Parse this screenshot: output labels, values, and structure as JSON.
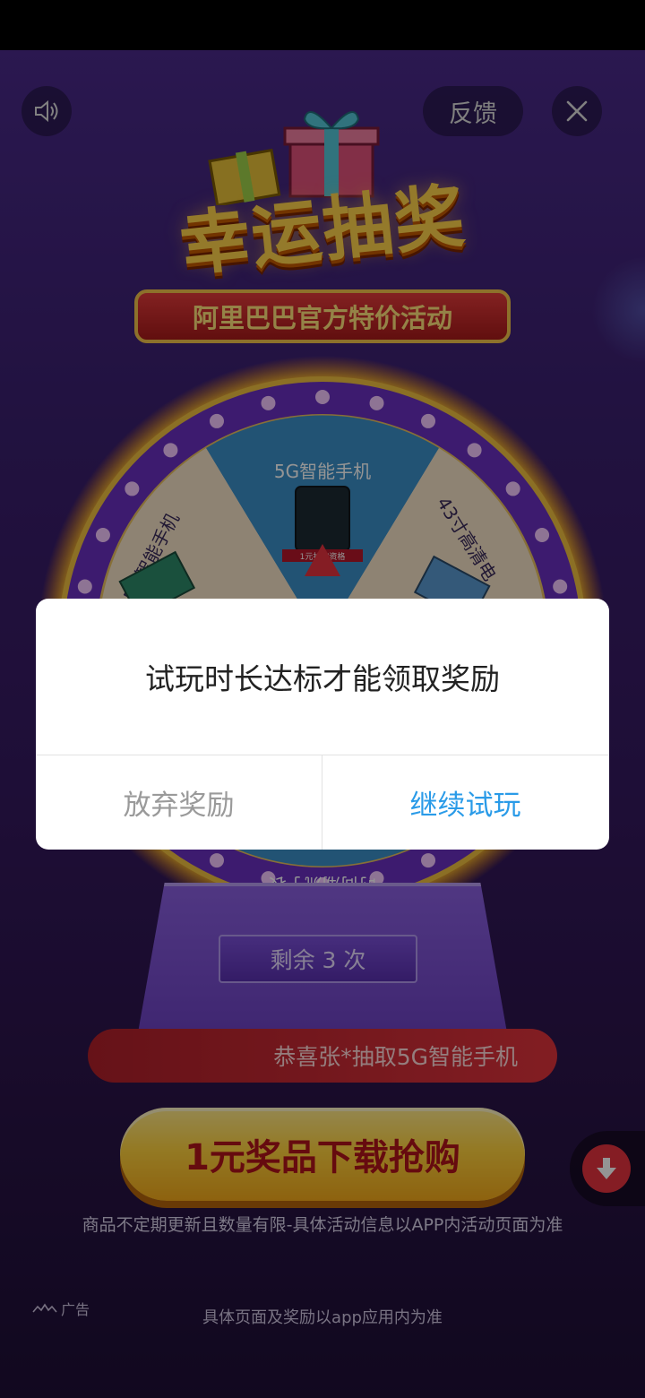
{
  "top_controls": {
    "sound_icon": "speaker-icon",
    "feedback_label": "反馈",
    "close_icon": "close-icon"
  },
  "banner": {
    "title": "幸运抽奖",
    "subtitle": "阿里巴巴官方特价活动"
  },
  "wheel": {
    "prizes": [
      "5G智能手机",
      "43寸高清电",
      "时尚潮流手表",
      "5G智能手机"
    ],
    "price_tag": "1元抢购资格"
  },
  "remaining_label": "剩余 3 次",
  "winner_text": "恭喜张*抽取5G智能手机",
  "cta_label": "1元奖品下载抢购",
  "disclaimer": "商品不定期更新且数量有限-具体活动信息以APP内活动页面为准",
  "ad_tag": "广告",
  "footer_note": "具体页面及奖励以app应用内为准",
  "dialog": {
    "message": "试玩时长达标才能领取奖励",
    "abandon_label": "放弃奖励",
    "continue_label": "继续试玩"
  },
  "colors": {
    "dialog_confirm": "#2a9be8",
    "dialog_cancel": "#9a9a9a",
    "cta_text": "#b0131a"
  }
}
